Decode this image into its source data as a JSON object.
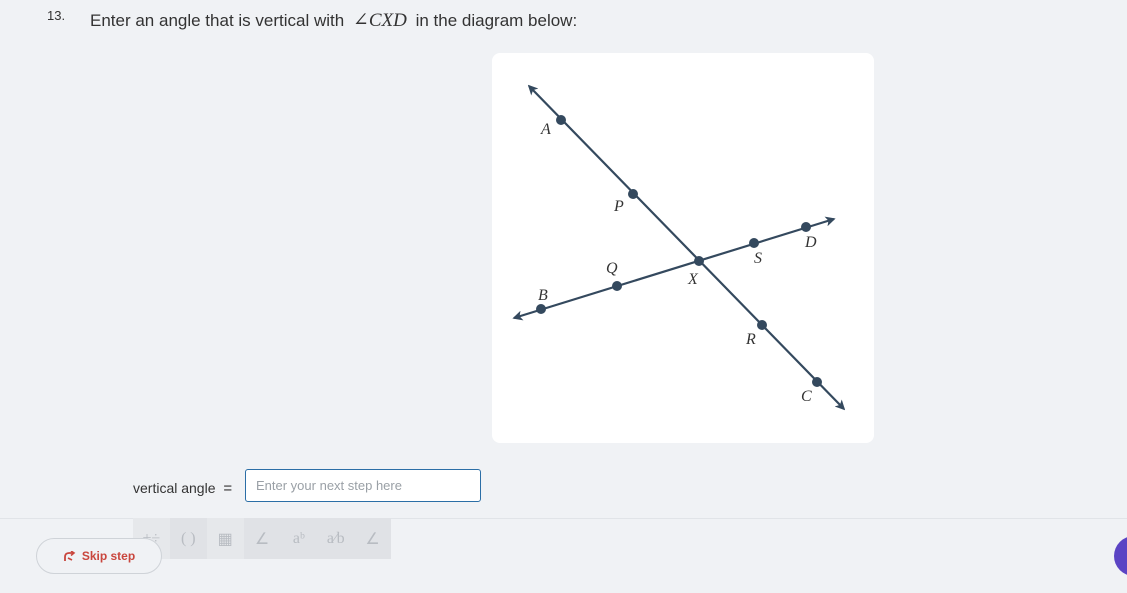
{
  "question": {
    "number": "13.",
    "text_before": "Enter an angle that is vertical with",
    "math_angle_symbol": "∠",
    "math_expression": "CXD",
    "text_after": "in the diagram below:"
  },
  "diagram": {
    "line_color": "#34495e",
    "points": {
      "A": "A",
      "P": "P",
      "X": "X",
      "R": "R",
      "C": "C",
      "B": "B",
      "Q": "Q",
      "S": "S",
      "D": "D"
    }
  },
  "answer": {
    "label": "vertical angle",
    "equals": "=",
    "placeholder": "Enter your next step here",
    "value": ""
  },
  "toolbar": {
    "tools": [
      {
        "name": "operators-icon",
        "symbol": "±÷"
      },
      {
        "name": "parentheses-icon",
        "symbol": "( )"
      },
      {
        "name": "matrix-icon",
        "symbol": "▦"
      },
      {
        "name": "angle-icon",
        "symbol": "∠"
      },
      {
        "name": "exponent-icon",
        "symbol": "aᵇ"
      },
      {
        "name": "fraction-icon",
        "symbol": "a⁄b"
      },
      {
        "name": "measured-angle-icon",
        "symbol": "∠"
      }
    ]
  },
  "footer": {
    "skip_label": "Skip step"
  },
  "colors": {
    "accent": "#2b6ea6",
    "skip": "#c9463d",
    "help": "#5b44c4"
  }
}
